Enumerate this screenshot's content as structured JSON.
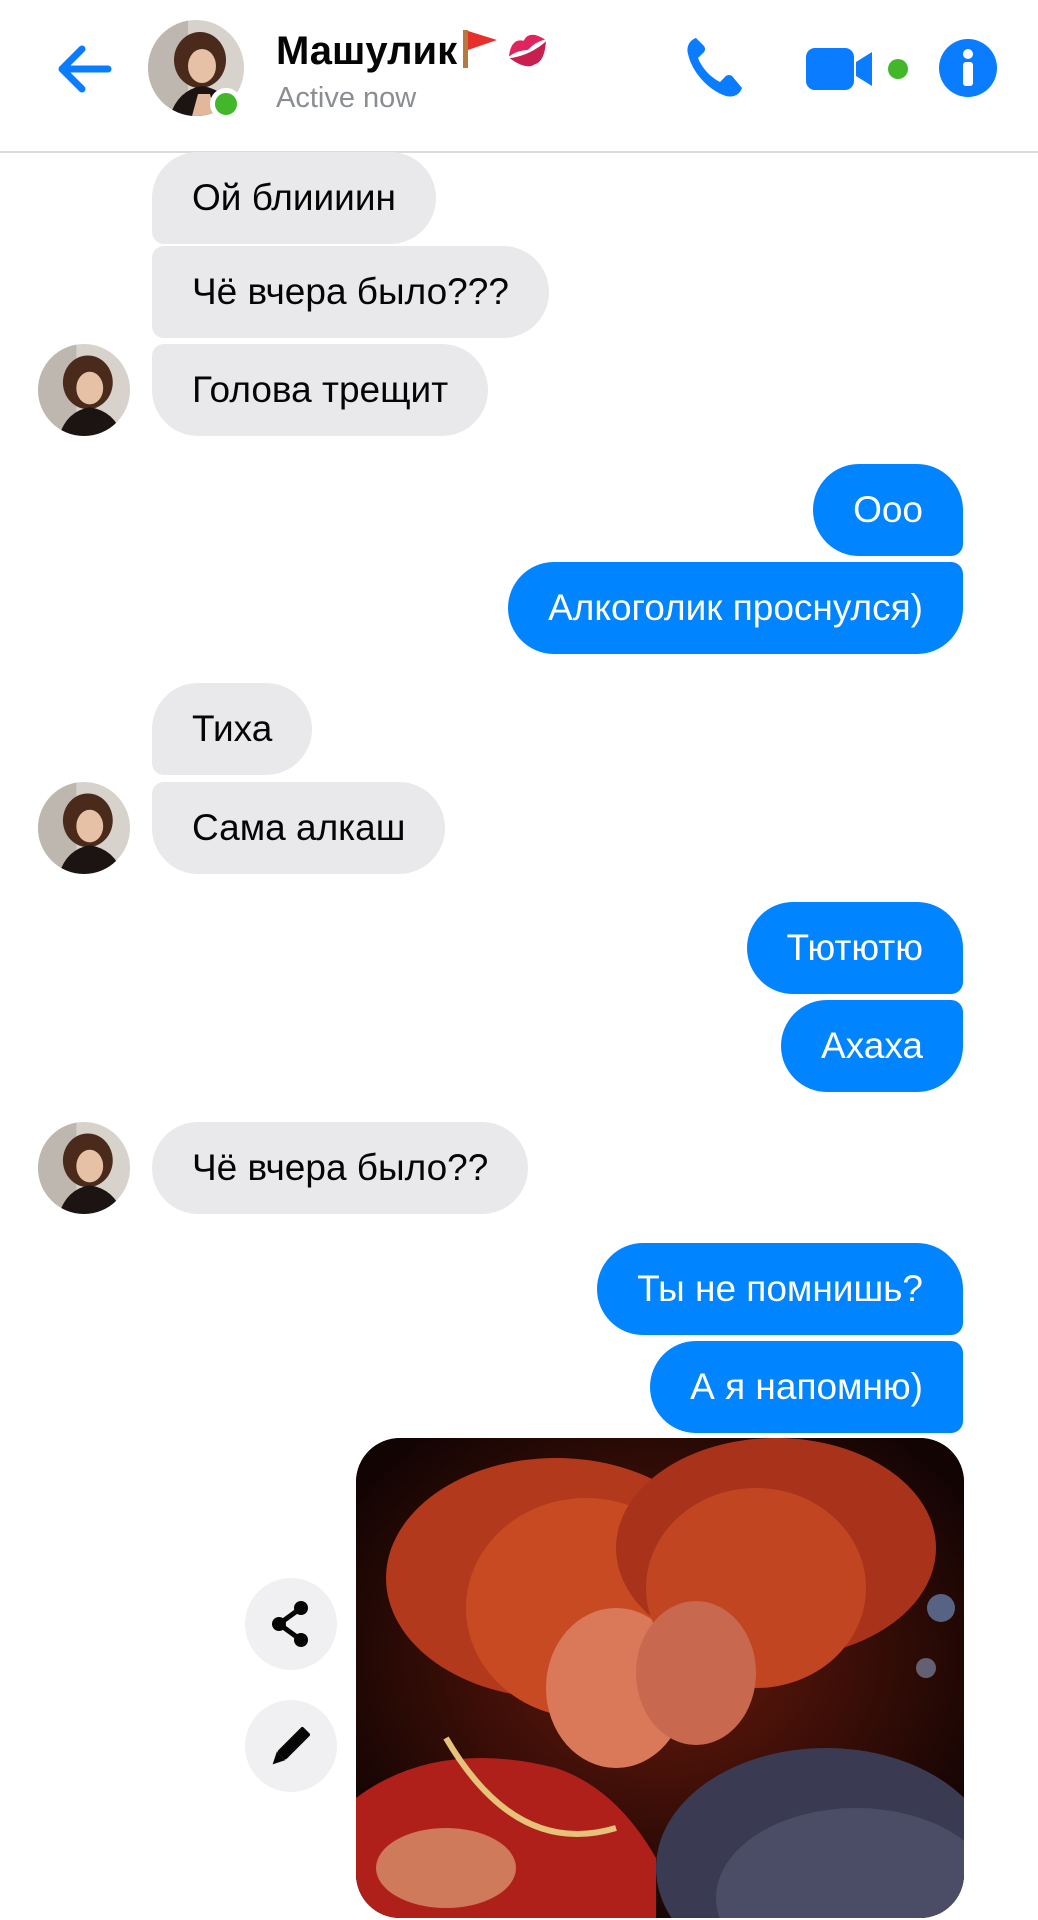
{
  "header": {
    "contact_name": "Машулик",
    "status": "Active now",
    "icons": [
      "back-arrow-icon",
      "phone-icon",
      "video-call-icon",
      "info-icon"
    ],
    "accent_color": "#0084ff",
    "online_color": "#42b72a"
  },
  "messages": [
    {
      "from": "contact",
      "text": "Ой блиииин"
    },
    {
      "from": "contact",
      "text": "Чё вчера было???"
    },
    {
      "from": "contact",
      "text": "Голова трещит"
    },
    {
      "from": "me",
      "text": "Ооо"
    },
    {
      "from": "me",
      "text": "Алкоголик проснулся)"
    },
    {
      "from": "contact",
      "text": "Тиха"
    },
    {
      "from": "contact",
      "text": "Сама алкаш"
    },
    {
      "from": "me",
      "text": "Тютютю"
    },
    {
      "from": "me",
      "text": "Ахаха"
    },
    {
      "from": "contact",
      "text": "Чё вчера было??"
    },
    {
      "from": "me",
      "text": "Ты не помнишь?"
    },
    {
      "from": "me",
      "text": "А я напомню)"
    }
  ],
  "attachment": {
    "type": "image",
    "actions": [
      "share-icon",
      "edit-icon"
    ]
  },
  "colors": {
    "incoming_bubble": "#e9e9ec",
    "outgoing_bubble": "#0084ff"
  }
}
